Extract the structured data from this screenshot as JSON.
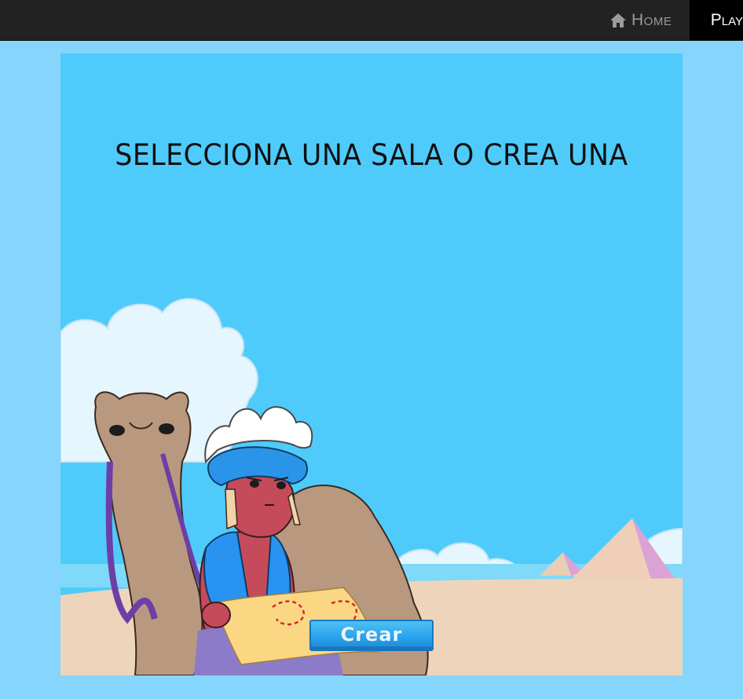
{
  "nav": {
    "home_label": "Home",
    "home_icon": "home-icon",
    "play_label": "Play",
    "play_icon": "play-icon"
  },
  "game": {
    "title": "SELECCIONA UNA SALA O CREA UNA",
    "create_button_label": "Crear"
  },
  "colors": {
    "page_background": "#86d5fd",
    "topbar": "#222222",
    "sky": "#4fcbfb",
    "sand": "#efd4bc",
    "button_blue": "#2aa4ec"
  }
}
